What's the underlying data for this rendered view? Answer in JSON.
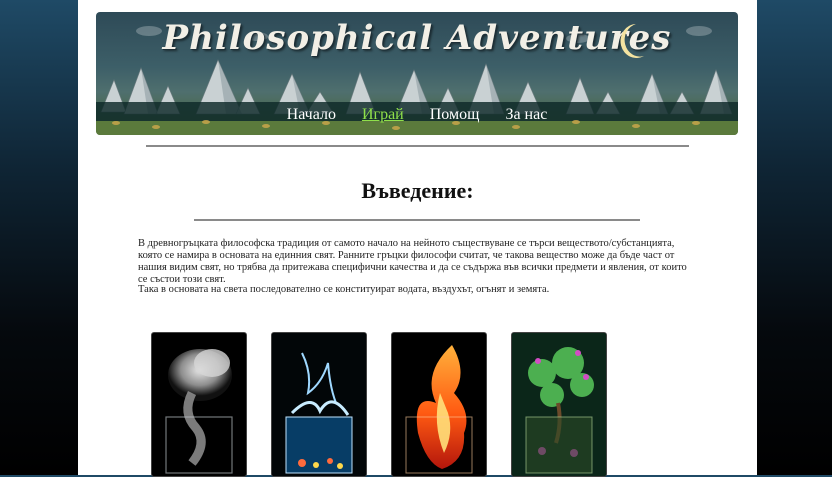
{
  "site": {
    "title": "Philosophical Adventures"
  },
  "nav": {
    "items": [
      {
        "label": "Начало",
        "active": false
      },
      {
        "label": "Играй",
        "active": true
      },
      {
        "label": "Помощ",
        "active": false
      },
      {
        "label": "За нас",
        "active": false
      }
    ]
  },
  "main": {
    "heading": "Въведение:",
    "paragraphs": [
      "В древногръцката философска традиция от самото начало на нейното съществуване се търси веществото/субстанцията, която се намира в основата на единния свят. Ранните гръцки философи считат, че такова вещество може да бъде част от нашия видим свят, но трябва да притежава специфични качества и да се съдържа във всички предмети и явления, от които се състои този свят.",
      "Така в основата на света последователно се конституират водата, въздухът, огънят и земята."
    ],
    "elements": [
      {
        "name": "air",
        "icon": "air-element-image"
      },
      {
        "name": "water",
        "icon": "water-element-image"
      },
      {
        "name": "fire",
        "icon": "fire-element-image"
      },
      {
        "name": "earth",
        "icon": "earth-element-image"
      }
    ]
  },
  "colors": {
    "nav_active": "#8fe04a",
    "nav_text": "#ffffff",
    "page_bg": "#ffffff"
  }
}
